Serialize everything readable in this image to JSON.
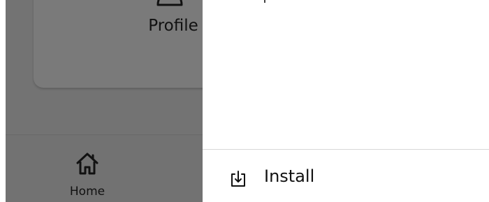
{
  "background_app": {
    "profile_card": {
      "label": "Profile",
      "icon": "person-icon"
    },
    "bottom_nav": {
      "items": [
        {
          "label": "Home",
          "icon": "home-icon"
        }
      ]
    }
  },
  "menu_sheet": {
    "items": [
      {
        "label": "Install",
        "icon": "install-icon"
      }
    ]
  },
  "colors": {
    "scrim": "#737373",
    "sheet_background": "#ffffff",
    "text": "#111111",
    "divider": "#d7d7d7"
  }
}
